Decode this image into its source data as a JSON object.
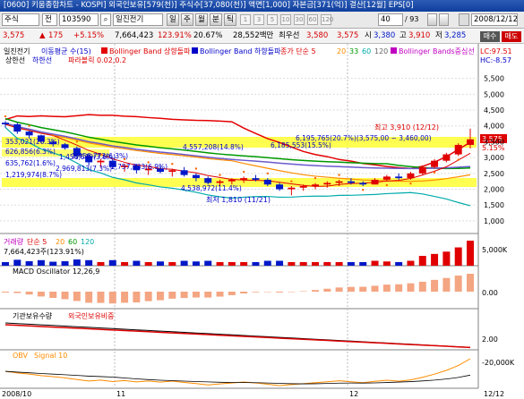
{
  "window": {
    "title": "[0600] 키움종합차트 - KOSPI] 외국인보유[579(천)] 주식수[37,080(천)] 액면[1,000] 자본금[371(억)] 결산[12월] EPS[0]"
  },
  "toolbar": {
    "type": "주식",
    "mode": "전",
    "code": "103590",
    "stock_name": "일진전기",
    "period_day": "일",
    "period_week": "주",
    "period_month": "월",
    "period_minute": "분",
    "period_tick": "틱",
    "intervals": [
      "1",
      "3",
      "5",
      "10",
      "30",
      "60",
      "120"
    ],
    "count": "40",
    "total": "93",
    "date": "2008/12/12"
  },
  "info": {
    "price": "3,575",
    "change": "175",
    "change_pct": "+5.15%",
    "volume": "7,664,423",
    "vol_ratio": "123.91%",
    "turnover": "20.67%",
    "amount": "28,552백만",
    "pref_label": "최우선",
    "ask": "3,580",
    "bid": "3,575",
    "open_label": "시",
    "open": "3,380",
    "high_label": "고",
    "high": "3,910",
    "low_label": "저",
    "low": "3,285",
    "sell": "매수",
    "buy": "매도"
  },
  "legend": {
    "stock": "일진전기",
    "ma": "이동평균 수(15)",
    "bb_upper": "Bollinger Band 상향돌파",
    "bb_lower": "Bollinger Band 하향돌파",
    "ma_group": "종가 단순 5",
    "ma20": "20",
    "ma33": "33",
    "ma60": "60",
    "ma120": "120",
    "bb_mid": "Bollinger Bands중심선",
    "lc": "LC:97.51",
    "hc": "HC:-8.57",
    "up": "상한선",
    "down": "하한선",
    "parabolic": "파라볼릭 0.02,0.2"
  },
  "annotations": {
    "high": "최고 3,910 (12/12)",
    "low": "최저 1,810 (11/21)",
    "box1": "4,557,208(14.8%)",
    "box2": "2,456,773(6.3%)",
    "box3": "2,757,833(6.9%)",
    "box4": "4,538,972(11.4%)",
    "box5": "6,185,553(15.5%)",
    "box6": "6,195,765(20.7%)(3,575,00 ~ 3,460,00)",
    "side1": "353,021(20.3%)",
    "side2": "626,856(6.3%)",
    "side3": "635,762(1.6%)",
    "side4": "1,219,974(8.7%)",
    "side5": "1,456,519(3.6%)",
    "side6": "2,969,813(7.3%)",
    "price_tag": "3,575",
    "pct_tag": "5.15%"
  },
  "price_axis": [
    "5,500",
    "5,000",
    "4,500",
    "4,000",
    "3,500",
    "3,000",
    "2,500",
    "2,000",
    "1,500",
    "1,000"
  ],
  "volume_panel": {
    "label": "거래량",
    "ma_label": "단순 5",
    "ma20": "20",
    "ma60": "60",
    "ma120": "120",
    "value": "7,664,423주(123.91%)",
    "axis": "5,000K"
  },
  "macd_panel": {
    "label": "MACD Oscillator 12,26,9",
    "axis": "0.00"
  },
  "holding_panel": {
    "label1": "기관보유수량",
    "label2": "외국인보유비중",
    "axis": "2.00"
  },
  "obv_panel": {
    "label1": "OBV",
    "label2": "Signal 10",
    "axis": "-20,000K"
  },
  "date_axis": [
    "2008/10",
    "11",
    "12",
    "12/12"
  ],
  "chart_data": {
    "type": "candlestick",
    "x": [
      "2008/10",
      "11",
      "12",
      "12/12"
    ],
    "candles": [
      [
        4100,
        4150,
        3950,
        4050
      ],
      [
        4050,
        4100,
        3750,
        3820
      ],
      [
        3820,
        3850,
        3600,
        3700
      ],
      [
        3700,
        3720,
        3450,
        3500
      ],
      [
        3500,
        3550,
        3350,
        3420
      ],
      [
        3420,
        3460,
        3250,
        3300
      ],
      [
        3300,
        3350,
        2950,
        3050
      ],
      [
        3050,
        3120,
        2750,
        2850
      ],
      [
        2850,
        2950,
        2700,
        2900
      ],
      [
        2900,
        2950,
        2650,
        2700
      ],
      [
        2700,
        2800,
        2550,
        2750
      ],
      [
        2750,
        2800,
        2500,
        2600
      ],
      [
        2600,
        2700,
        2450,
        2650
      ],
      [
        2650,
        2750,
        2500,
        2550
      ],
      [
        2550,
        2650,
        2400,
        2600
      ],
      [
        2600,
        2700,
        2400,
        2450
      ],
      [
        2450,
        2500,
        2250,
        2350
      ],
      [
        2350,
        2400,
        2150,
        2200
      ],
      [
        2200,
        2300,
        2100,
        2250
      ],
      [
        2250,
        2350,
        2150,
        2300
      ],
      [
        2300,
        2400,
        2200,
        2350
      ],
      [
        2350,
        2450,
        2250,
        2300
      ],
      [
        2300,
        2350,
        2100,
        2150
      ],
      [
        2150,
        2200,
        1950,
        2000
      ],
      [
        2000,
        2100,
        1810,
        2050
      ],
      [
        2050,
        2150,
        1950,
        2100
      ],
      [
        2100,
        2200,
        2000,
        2150
      ],
      [
        2150,
        2250,
        2050,
        2200
      ],
      [
        2200,
        2300,
        2100,
        2250
      ],
      [
        2250,
        2350,
        2150,
        2200
      ],
      [
        2200,
        2250,
        2100,
        2150
      ],
      [
        2150,
        2350,
        2150,
        2300
      ],
      [
        2300,
        2450,
        2250,
        2400
      ],
      [
        2400,
        2500,
        2300,
        2350
      ],
      [
        2350,
        2550,
        2300,
        2500
      ],
      [
        2500,
        2750,
        2450,
        2700
      ],
      [
        2700,
        2950,
        2650,
        2900
      ],
      [
        2900,
        3150,
        2850,
        3100
      ],
      [
        3100,
        3450,
        3050,
        3400
      ],
      [
        3400,
        3910,
        3285,
        3575
      ]
    ],
    "ylim": [
      800,
      5800
    ],
    "volume_max": 7664423
  }
}
